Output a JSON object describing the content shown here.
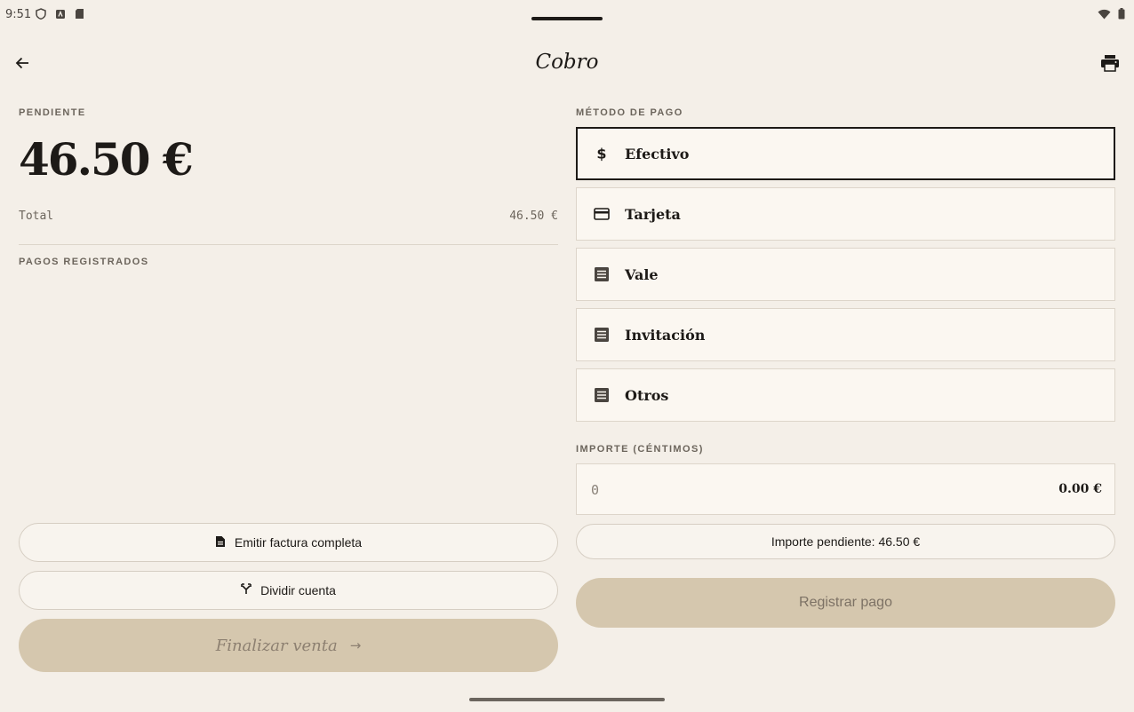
{
  "status_bar": {
    "time": "9:51"
  },
  "header": {
    "title": "Cobro"
  },
  "summary": {
    "pending_label": "PENDIENTE",
    "pending_amount": "46.50 €",
    "total_label": "Total",
    "total_value": "46.50 €",
    "payments_label": "PAGOS REGISTRADOS"
  },
  "actions": {
    "invoice_label": "Emitir factura completa",
    "split_label": "Dividir cuenta",
    "finalize_label": "Finalizar venta",
    "finalize_arrow": "→"
  },
  "payment": {
    "method_label": "MÉTODO DE PAGO",
    "methods": [
      {
        "label": "Efectivo",
        "icon": "dollar-icon",
        "selected": true
      },
      {
        "label": "Tarjeta",
        "icon": "credit-card-icon",
        "selected": false
      },
      {
        "label": "Vale",
        "icon": "voucher-icon",
        "selected": false
      },
      {
        "label": "Invitación",
        "icon": "invitation-icon",
        "selected": false
      },
      {
        "label": "Otros",
        "icon": "other-icon",
        "selected": false
      }
    ],
    "amount_label": "IMPORTE (CÉNTIMOS)",
    "amount_placeholder": "0",
    "amount_preview": "0.00 €",
    "pending_button_label": "Importe pendiente: 46.50 €",
    "register_label": "Registrar pago"
  },
  "colors": {
    "background": "#f4efe8",
    "accent_disabled": "#d5c7ae",
    "text": "#1d1a17"
  }
}
